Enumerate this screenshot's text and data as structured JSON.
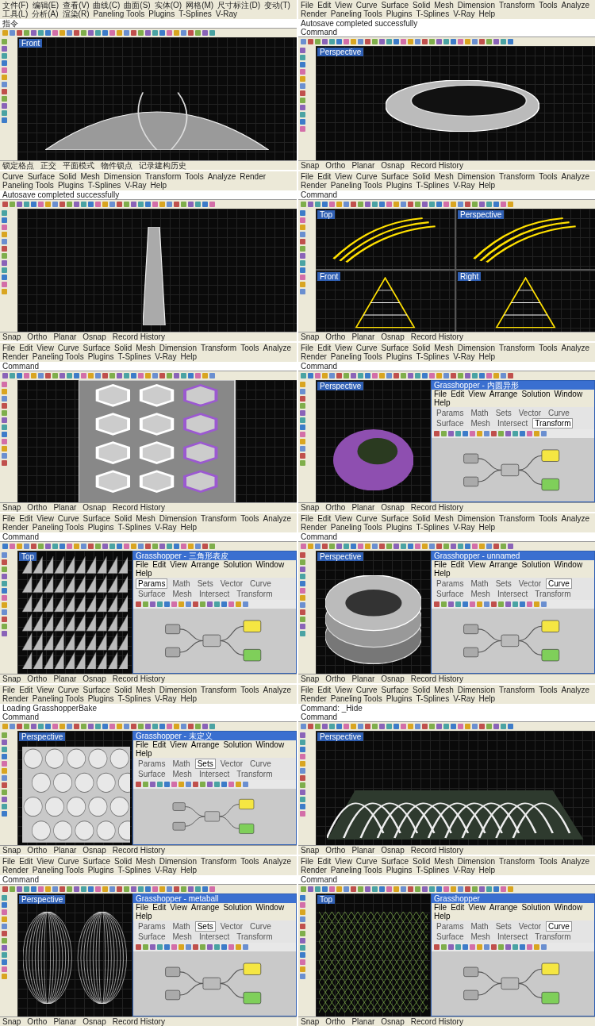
{
  "panels": [
    {
      "menu": [
        "文件(F)",
        "编辑(E)",
        "查看(V)",
        "曲线(C)",
        "曲面(S)",
        "实体(O)",
        "网格(M)",
        "尺寸标注(D)",
        "变动(T)",
        "工具(L)",
        "分析(A)",
        "渲染(R)",
        "Paneling Tools",
        "Plugins",
        "T-Splines",
        "V-Ray"
      ],
      "command": [
        "指令"
      ],
      "viewports": [
        {
          "label": "Front",
          "kind": "dome"
        }
      ],
      "status": [
        "锁定格点",
        "正交",
        "平面模式",
        "物件锁点",
        "记录建构历史"
      ]
    },
    {
      "menu": [
        "File",
        "Edit",
        "View",
        "Curve",
        "Surface",
        "Solid",
        "Mesh",
        "Dimension",
        "Transform",
        "Tools",
        "Analyze",
        "Render",
        "Paneling Tools",
        "Plugins",
        "T-Splines",
        "V-Ray",
        "Help"
      ],
      "command": [
        "Autosave completed successfully",
        "Command"
      ],
      "viewports": [
        {
          "label": "Perspective",
          "kind": "twisted-ring"
        }
      ],
      "status": [
        "Snap",
        "Ortho",
        "Planar",
        "Osnap",
        "Record History"
      ]
    },
    {
      "menu": [
        "Curve",
        "Surface",
        "Solid",
        "Mesh",
        "Dimension",
        "Transform",
        "Tools",
        "Analyze",
        "Render",
        "Paneling Tools",
        "Plugins",
        "T-Splines",
        "V-Ray",
        "Help"
      ],
      "command": [
        "Autosave completed successfully"
      ],
      "viewports": [
        {
          "kind": "tower"
        }
      ],
      "status": [
        "Snap",
        "Ortho",
        "Planar",
        "Osnap",
        "Record History"
      ]
    },
    {
      "menu": [
        "File",
        "Edit",
        "View",
        "Curve",
        "Surface",
        "Solid",
        "Mesh",
        "Dimension",
        "Transform",
        "Tools",
        "Analyze",
        "Render",
        "Paneling Tools",
        "Plugins",
        "T-Splines",
        "V-Ray",
        "Help"
      ],
      "command": [
        "Command"
      ],
      "viewports": [
        {
          "label": "Top",
          "kind": "ribbons"
        },
        {
          "label": "Perspective",
          "kind": "ribbons"
        },
        {
          "label": "Front",
          "kind": "ribbon-tower"
        },
        {
          "label": "Right",
          "kind": "ribbon-tower"
        }
      ],
      "status": [
        "Snap",
        "Ortho",
        "Planar",
        "Osnap",
        "Record History"
      ]
    },
    {
      "menu": [
        "File",
        "Edit",
        "View",
        "Curve",
        "Surface",
        "Solid",
        "Mesh",
        "Dimension",
        "Transform",
        "Tools",
        "Analyze",
        "Render",
        "Paneling Tools",
        "Plugins",
        "T-Splines",
        "V-Ray",
        "Help"
      ],
      "command": [
        "Command"
      ],
      "viewports": [
        {
          "kind": "hexagon-tower"
        }
      ],
      "status": [
        "Snap",
        "Ortho",
        "Planar",
        "Osnap",
        "Record History"
      ]
    },
    {
      "menu": [
        "File",
        "Edit",
        "View",
        "Curve",
        "Surface",
        "Solid",
        "Mesh",
        "Dimension",
        "Transform",
        "Tools",
        "Analyze",
        "Render",
        "Paneling Tools",
        "Plugins",
        "T-Splines",
        "V-Ray",
        "Help"
      ],
      "command": [
        "Command"
      ],
      "viewports": [
        {
          "label": "Perspective",
          "kind": "torus"
        }
      ],
      "status": [
        "Snap",
        "Ortho",
        "Planar",
        "Osnap",
        "Record History"
      ],
      "gh": {
        "title": "Grasshopper - 内圆异形",
        "menu": [
          "File",
          "Edit",
          "View",
          "Arrange",
          "Solution",
          "Window",
          "Help"
        ],
        "tabs": [
          {
            "label": "Params",
            "selected": false
          },
          {
            "label": "Math",
            "selected": false
          },
          {
            "label": "Sets",
            "selected": false
          },
          {
            "label": "Vector",
            "selected": false
          },
          {
            "label": "Curve",
            "selected": false
          },
          {
            "label": "Surface",
            "selected": false
          },
          {
            "label": "Mesh",
            "selected": false
          },
          {
            "label": "Intersect",
            "selected": false
          },
          {
            "label": "Transform",
            "selected": true
          }
        ]
      }
    },
    {
      "menu": [
        "File",
        "Edit",
        "View",
        "Curve",
        "Surface",
        "Solid",
        "Mesh",
        "Dimension",
        "Transform",
        "Tools",
        "Analyze",
        "Render",
        "Paneling Tools",
        "Plugins",
        "T-Splines",
        "V-Ray",
        "Help"
      ],
      "command": [
        "Command"
      ],
      "viewports": [
        {
          "label": "Top",
          "kind": "triangle-panels"
        }
      ],
      "status": [
        "Snap",
        "Ortho",
        "Planar",
        "Osnap",
        "Record History"
      ],
      "gh": {
        "title": "Grasshopper - 三角形表皮",
        "menu": [
          "File",
          "Edit",
          "View",
          "Arrange",
          "Solution",
          "Window",
          "Help"
        ],
        "tabs": [
          {
            "label": "Params",
            "selected": true
          },
          {
            "label": "Math",
            "selected": false
          },
          {
            "label": "Sets",
            "selected": false
          },
          {
            "label": "Vector",
            "selected": false
          },
          {
            "label": "Curve",
            "selected": false
          },
          {
            "label": "Surface",
            "selected": false
          },
          {
            "label": "Mesh",
            "selected": false
          },
          {
            "label": "Intersect",
            "selected": false
          },
          {
            "label": "Transform",
            "selected": false
          }
        ]
      }
    },
    {
      "menu": [
        "File",
        "Edit",
        "View",
        "Curve",
        "Surface",
        "Solid",
        "Mesh",
        "Dimension",
        "Transform",
        "Tools",
        "Analyze",
        "Render",
        "Paneling Tools",
        "Plugins",
        "T-Splines",
        "V-Ray",
        "Help"
      ],
      "command": [
        "Command"
      ],
      "viewports": [
        {
          "label": "Perspective",
          "kind": "stacked-ring"
        }
      ],
      "status": [
        "Snap",
        "Ortho",
        "Planar",
        "Osnap",
        "Record History"
      ],
      "gh": {
        "title": "Grasshopper - unnamed",
        "menu": [
          "File",
          "Edit",
          "View",
          "Arrange",
          "Solution",
          "Window",
          "Help"
        ],
        "tabs": [
          {
            "label": "Params",
            "selected": false
          },
          {
            "label": "Math",
            "selected": false
          },
          {
            "label": "Sets",
            "selected": false
          },
          {
            "label": "Vector",
            "selected": false
          },
          {
            "label": "Curve",
            "selected": true
          },
          {
            "label": "Surface",
            "selected": false
          },
          {
            "label": "Mesh",
            "selected": false
          },
          {
            "label": "Intersect",
            "selected": false
          },
          {
            "label": "Transform",
            "selected": false
          }
        ]
      }
    },
    {
      "menu": [
        "File",
        "Edit",
        "View",
        "Curve",
        "Surface",
        "Solid",
        "Mesh",
        "Dimension",
        "Transform",
        "Tools",
        "Analyze",
        "Render",
        "Paneling Tools",
        "Plugins",
        "T-Splines",
        "V-Ray",
        "Help"
      ],
      "command": [
        "Loading GrasshopperBake",
        "Command"
      ],
      "viewports": [
        {
          "label": "Perspective",
          "kind": "cell-surface"
        }
      ],
      "status": [
        "Snap",
        "Ortho",
        "Planar",
        "Osnap",
        "Record History"
      ],
      "gh": {
        "title": "Grasshopper - 未定义",
        "menu": [
          "File",
          "Edit",
          "View",
          "Arrange",
          "Solution",
          "Window",
          "Help"
        ],
        "tabs": [
          {
            "label": "Params",
            "selected": false
          },
          {
            "label": "Math",
            "selected": false
          },
          {
            "label": "Sets",
            "selected": true
          },
          {
            "label": "Vector",
            "selected": false
          },
          {
            "label": "Curve",
            "selected": false
          },
          {
            "label": "Surface",
            "selected": false
          },
          {
            "label": "Mesh",
            "selected": false
          },
          {
            "label": "Intersect",
            "selected": false
          },
          {
            "label": "Transform",
            "selected": false
          }
        ]
      }
    },
    {
      "menu": [
        "File",
        "Edit",
        "View",
        "Curve",
        "Surface",
        "Solid",
        "Mesh",
        "Dimension",
        "Transform",
        "Tools",
        "Analyze",
        "Render",
        "Paneling Tools",
        "Plugins",
        "T-Splines",
        "V-Ray",
        "Help"
      ],
      "command": [
        "Command: _Hide",
        "Command"
      ],
      "viewports": [
        {
          "label": "Perspective",
          "kind": "arches"
        }
      ],
      "status": [
        "Snap",
        "Ortho",
        "Planar",
        "Osnap",
        "Record History"
      ]
    },
    {
      "menu": [
        "File",
        "Edit",
        "View",
        "Curve",
        "Surface",
        "Solid",
        "Mesh",
        "Dimension",
        "Transform",
        "Tools",
        "Analyze",
        "Render",
        "Paneling Tools",
        "Plugins",
        "T-Splines",
        "V-Ray",
        "Help"
      ],
      "command": [
        "Command"
      ],
      "viewports": [
        {
          "label": "Perspective",
          "kind": "wireframe-shells"
        }
      ],
      "status": [
        "Snap",
        "Ortho",
        "Planar",
        "Osnap",
        "Record History"
      ],
      "gh": {
        "title": "Grasshopper - metaball",
        "menu": [
          "File",
          "Edit",
          "View",
          "Arrange",
          "Solution",
          "Window",
          "Help"
        ],
        "tabs": [
          {
            "label": "Params",
            "selected": false
          },
          {
            "label": "Math",
            "selected": false
          },
          {
            "label": "Sets",
            "selected": true
          },
          {
            "label": "Vector",
            "selected": false
          },
          {
            "label": "Curve",
            "selected": false
          },
          {
            "label": "Surface",
            "selected": false
          },
          {
            "label": "Mesh",
            "selected": false
          },
          {
            "label": "Intersect",
            "selected": false
          },
          {
            "label": "Transform",
            "selected": false
          }
        ]
      }
    },
    {
      "menu": [
        "File",
        "Edit",
        "View",
        "Curve",
        "Surface",
        "Solid",
        "Mesh",
        "Dimension",
        "Transform",
        "Tools",
        "Analyze",
        "Render",
        "Paneling Tools",
        "Plugins",
        "T-Splines",
        "V-Ray",
        "Help"
      ],
      "command": [
        "Command"
      ],
      "viewports": [
        {
          "label": "Top",
          "kind": "lattice"
        }
      ],
      "status": [
        "Snap",
        "Ortho",
        "Planar",
        "Osnap",
        "Record History"
      ],
      "gh": {
        "title": "Grasshopper",
        "menu": [
          "File",
          "Edit",
          "View",
          "Arrange",
          "Solution",
          "Window",
          "Help"
        ],
        "tabs": [
          {
            "label": "Params",
            "selected": false
          },
          {
            "label": "Math",
            "selected": false
          },
          {
            "label": "Sets",
            "selected": false
          },
          {
            "label": "Vector",
            "selected": false
          },
          {
            "label": "Curve",
            "selected": true
          },
          {
            "label": "Surface",
            "selected": false
          },
          {
            "label": "Mesh",
            "selected": false
          },
          {
            "label": "Intersect",
            "selected": false
          },
          {
            "label": "Transform",
            "selected": false
          }
        ]
      }
    }
  ]
}
